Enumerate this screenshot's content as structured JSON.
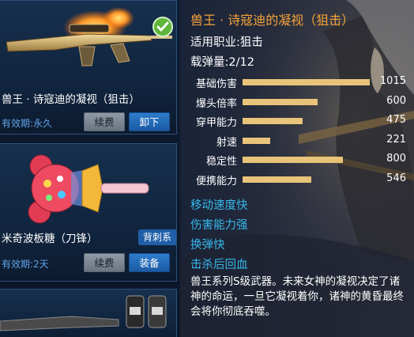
{
  "inventory": {
    "items": [
      {
        "name": "兽王 · 诗寇迪的凝视（狙击）",
        "validity": "有效期:永久",
        "renew_label": "续费",
        "action_label": "卸下",
        "equipped": true
      },
      {
        "name": "米奇波板糖（刀锋）",
        "validity": "有效期:2天",
        "renew_label": "续费",
        "action_label": "装备",
        "tag": "背刺系"
      }
    ]
  },
  "detail": {
    "title": "兽王 · 诗寇迪的凝视（狙击）",
    "job": "适用职业:狙击",
    "ammo": "载弹量:2/12",
    "stats": [
      {
        "label": "基础伤害",
        "value": "1015",
        "level": 1.0
      },
      {
        "label": "爆头倍率",
        "value": "600",
        "level": 0.59
      },
      {
        "label": "穿甲能力",
        "value": "475",
        "level": 0.47
      },
      {
        "label": "射速",
        "value": "221",
        "level": 0.22
      },
      {
        "label": "稳定性",
        "value": "800",
        "level": 0.79
      },
      {
        "label": "便携能力",
        "value": "546",
        "level": 0.54
      }
    ],
    "features": [
      "移动速度快",
      "伤害能力强",
      "换弹快",
      "击杀后回血"
    ],
    "description": "兽王系列S级武器。未来女神的凝视决定了诸神的命运，一旦它凝视着你，诸神的黄昏最终会将你彻底吞噬。"
  },
  "colors": {
    "title": "#f4a33a",
    "feature": "#37b8ec",
    "bar": "#e8c47a",
    "validity": "#5fa3e8"
  }
}
